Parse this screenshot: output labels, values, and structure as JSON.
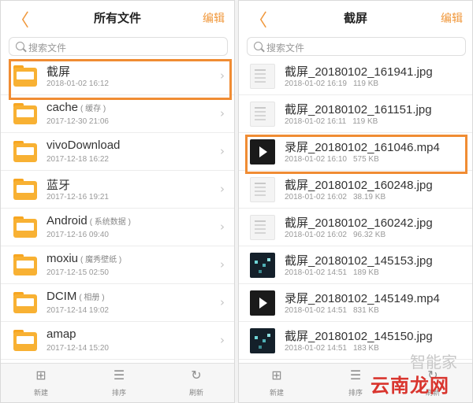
{
  "left": {
    "title": "所有文件",
    "back": "〈",
    "edit": "编辑",
    "search_placeholder": "搜索文件",
    "items": [
      {
        "name": "截屏",
        "date": "2018-01-02 16:12"
      },
      {
        "name": "cache",
        "note": "( 缓存 )",
        "date": "2017-12-30 21:06"
      },
      {
        "name": "vivoDownload",
        "date": "2017-12-18 16:22"
      },
      {
        "name": "蓝牙",
        "date": "2017-12-16 19:21"
      },
      {
        "name": "Android",
        "note": "( 系统数据 )",
        "date": "2017-12-16 09:40"
      },
      {
        "name": "moxiu",
        "note": "( 魔秀壁纸 )",
        "date": "2017-12-15 02:50"
      },
      {
        "name": "DCIM",
        "note": "( 相册 )",
        "date": "2017-12-14 19:02"
      },
      {
        "name": "amap",
        "date": "2017-12-14 15:20"
      }
    ],
    "toolbar": {
      "new": "新建",
      "sort": "排序",
      "refresh": "刷新"
    }
  },
  "right": {
    "title": "截屏",
    "back": "〈",
    "edit": "编辑",
    "search_placeholder": "搜索文件",
    "items": [
      {
        "name": "截屏_20180102_161941.jpg",
        "date": "2018-01-02 16:19",
        "size": "119 KB",
        "thumb": "light"
      },
      {
        "name": "截屏_20180102_161151.jpg",
        "date": "2018-01-02 16:11",
        "size": "119 KB",
        "thumb": "light"
      },
      {
        "name": "录屏_20180102_161046.mp4",
        "date": "2018-01-02 16:10",
        "size": "575 KB",
        "thumb": "video"
      },
      {
        "name": "截屏_20180102_160248.jpg",
        "date": "2018-01-02 16:02",
        "size": "38.19 KB",
        "thumb": "light"
      },
      {
        "name": "截屏_20180102_160242.jpg",
        "date": "2018-01-02 16:02",
        "size": "96.32 KB",
        "thumb": "light"
      },
      {
        "name": "截屏_20180102_145153.jpg",
        "date": "2018-01-02 14:51",
        "size": "189 KB",
        "thumb": "dark"
      },
      {
        "name": "录屏_20180102_145149.mp4",
        "date": "2018-01-02 14:51",
        "size": "831 KB",
        "thumb": "video"
      },
      {
        "name": "截屏_20180102_145150.jpg",
        "date": "2018-01-02 14:51",
        "size": "183 KB",
        "thumb": "dark"
      }
    ],
    "toolbar": {
      "new": "新建",
      "sort": "排序",
      "refresh": "刷新"
    }
  },
  "watermark": "云南龙网",
  "watermark_faint": "智能家",
  "colors": {
    "accent": "#f0973a",
    "highlight": "#f08c33",
    "folder": "#f8b133"
  }
}
